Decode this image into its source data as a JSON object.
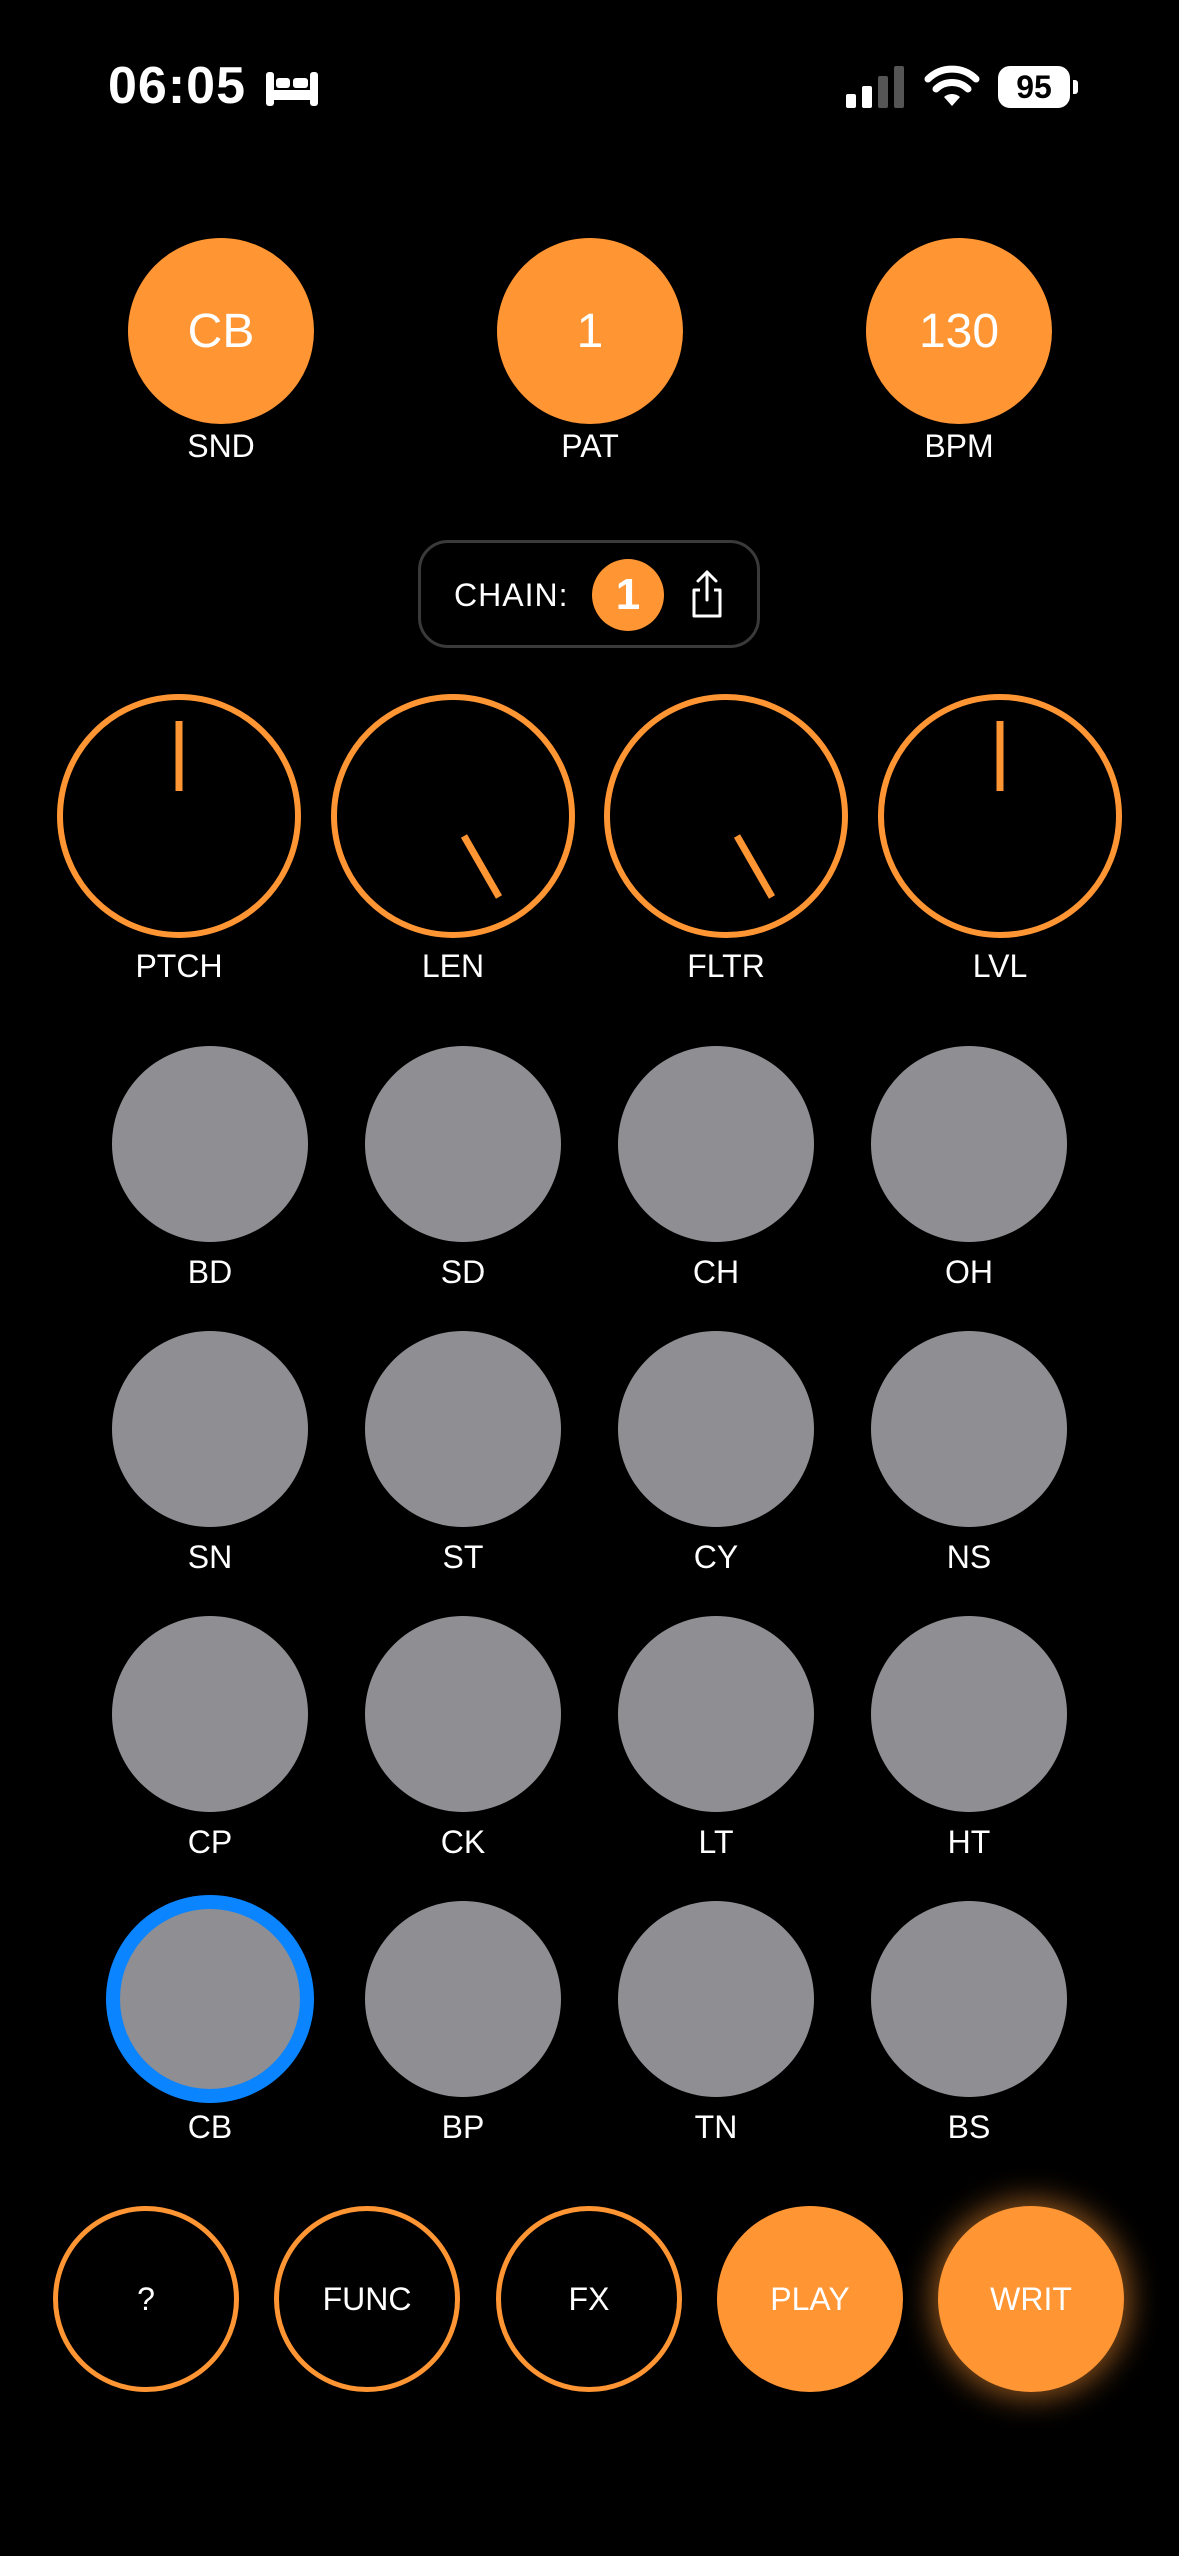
{
  "status": {
    "time": "06:05",
    "battery": "95"
  },
  "top": [
    {
      "value": "CB",
      "label": "SND"
    },
    {
      "value": "1",
      "label": "PAT"
    },
    {
      "value": "130",
      "label": "BPM"
    }
  ],
  "chain": {
    "label": "CHAIN:",
    "value": "1"
  },
  "knobs": [
    {
      "label": "PTCH"
    },
    {
      "label": "LEN"
    },
    {
      "label": "FLTR"
    },
    {
      "label": "LVL"
    }
  ],
  "pads": [
    [
      "BD",
      "SD",
      "CH",
      "OH"
    ],
    [
      "SN",
      "ST",
      "CY",
      "NS"
    ],
    [
      "CP",
      "CK",
      "LT",
      "HT"
    ],
    [
      "CB",
      "BP",
      "TN",
      "BS"
    ]
  ],
  "bottom": [
    "?",
    "FUNC",
    "FX",
    "PLAY",
    "WRIT"
  ],
  "colors": {
    "accent": "#FF9533",
    "pad": "#8E8E93",
    "selected": "#0A84FF"
  }
}
